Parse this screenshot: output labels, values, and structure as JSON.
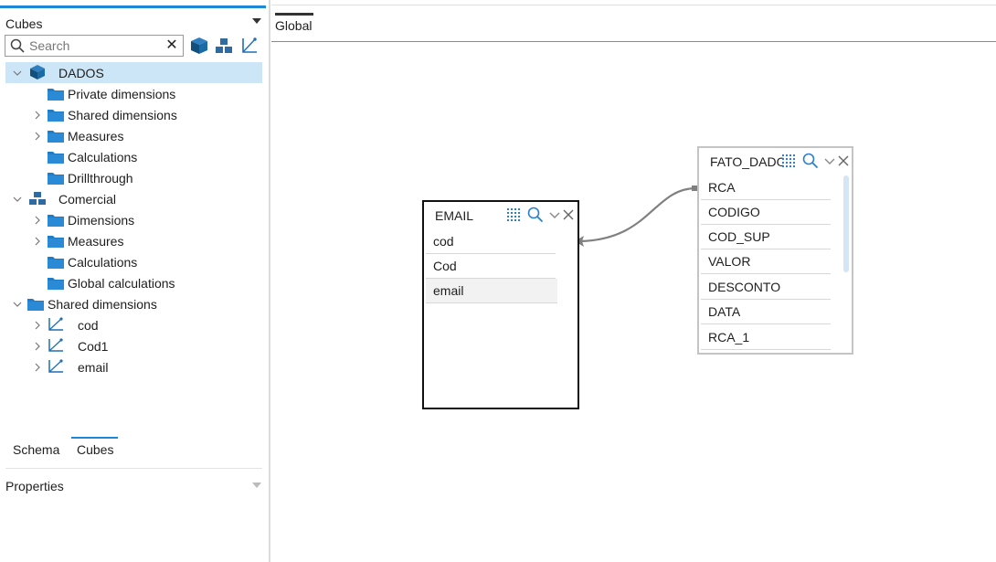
{
  "cubes_panel": {
    "title": "Cubes",
    "search": {
      "placeholder": "Search",
      "value": ""
    },
    "toolbar": [
      "cube-icon",
      "dimension-icon",
      "hierarchy-icon"
    ]
  },
  "tree": [
    {
      "label": "DADOS",
      "icon": "cube-icon",
      "expanded": true,
      "selected": true
    },
    {
      "label": "Private dimensions",
      "icon": "folder-icon"
    },
    {
      "label": "Shared dimensions",
      "icon": "folder-icon"
    },
    {
      "label": "Measures",
      "icon": "folder-icon"
    },
    {
      "label": "Calculations",
      "icon": "folder-icon"
    },
    {
      "label": "Drillthrough",
      "icon": "folder-icon"
    },
    {
      "label": "Comercial",
      "icon": "dimension-icon",
      "expanded": true
    },
    {
      "label": "Dimensions",
      "icon": "folder-icon"
    },
    {
      "label": "Measures",
      "icon": "folder-icon"
    },
    {
      "label": "Calculations",
      "icon": "folder-icon"
    },
    {
      "label": "Global calculations",
      "icon": "folder-icon"
    },
    {
      "label": "Shared dimensions",
      "icon": "folder-icon",
      "expanded": true
    },
    {
      "label": "cod",
      "icon": "hierarchy-icon"
    },
    {
      "label": "Cod1",
      "icon": "hierarchy-icon"
    },
    {
      "label": "email",
      "icon": "hierarchy-icon"
    }
  ],
  "bottom_tabs": {
    "schema": "Schema",
    "cubes": "Cubes",
    "active": "Cubes"
  },
  "properties": {
    "title": "Properties"
  },
  "workspace": {
    "tab": "Global",
    "tables": {
      "email": {
        "title": "EMAIL",
        "columns": [
          "cod",
          "Cod",
          "email"
        ],
        "highlighted": "email"
      },
      "fato": {
        "title": "FATO_DADOS",
        "columns": [
          "RCA",
          "CODIGO",
          "COD_SUP",
          "VALOR",
          "DESCONTO",
          "DATA",
          "RCA_1"
        ]
      }
    }
  },
  "colors": {
    "accent": "#1e88d6",
    "selected_row": "#cde6f7",
    "folder": "#1e7cc8",
    "cube": "#124f7c"
  }
}
